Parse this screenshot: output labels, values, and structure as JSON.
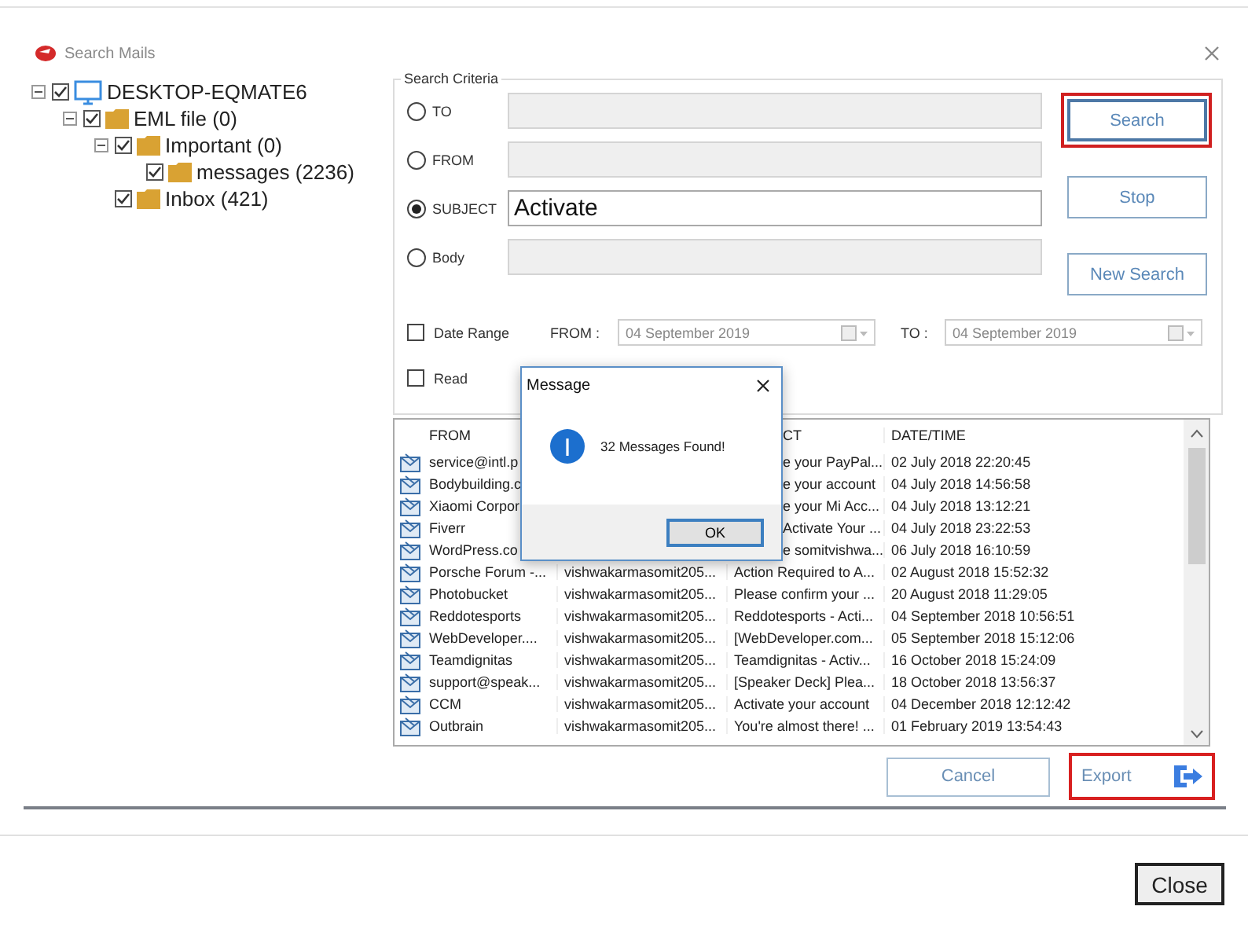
{
  "window": {
    "title": "Search Mails"
  },
  "tree": [
    {
      "label": "DESKTOP-EQMATE6",
      "kind": "computer",
      "checked": true,
      "expanded": true,
      "children": [
        {
          "label": "EML file (0)",
          "kind": "folder",
          "checked": true,
          "expanded": true,
          "children": [
            {
              "label": "Important (0)",
              "kind": "folder",
              "checked": true,
              "expanded": true,
              "children": [
                {
                  "label": "messages (2236)",
                  "kind": "folder",
                  "checked": true
                }
              ]
            },
            {
              "label": "Inbox (421)",
              "kind": "folder",
              "checked": true
            }
          ]
        }
      ]
    }
  ],
  "search_criteria": {
    "title": "Search Criteria",
    "fields": [
      {
        "label": "TO",
        "selected": false,
        "disabled": true
      },
      {
        "label": "FROM",
        "selected": false,
        "disabled": true
      },
      {
        "label": "SUBJECT",
        "selected": true,
        "disabled": false,
        "value": "Activate"
      },
      {
        "label": "Body",
        "selected": false,
        "disabled": true
      }
    ],
    "buttons": [
      {
        "label": "Search",
        "highlighted": true
      },
      {
        "label": "Stop",
        "highlighted": false
      },
      {
        "label": "New Search",
        "highlighted": false
      }
    ],
    "date_range": {
      "label": "Date Range",
      "checked": false,
      "from_label": "FROM :",
      "from_value": "04 September 2019",
      "to_label": "TO :",
      "to_value": "04 September 2019"
    },
    "filters": [
      {
        "label": "Read",
        "checked": false
      }
    ]
  },
  "table": {
    "header": {
      "from": "FROM",
      "subject": "CT",
      "date": "DATE/TIME"
    },
    "rows": [
      {
        "from": "service@intl.p",
        "subject": "e your PayPal...",
        "date": "02 July 2018 22:20:45"
      },
      {
        "from": "Bodybuilding.c",
        "subject": "e your account",
        "date": "04 July 2018 14:56:58"
      },
      {
        "from": "Xiaomi Corpor",
        "subject": "e your Mi Acc...",
        "date": "04 July 2018 13:12:21"
      },
      {
        "from": "Fiverr",
        "subject": "Activate Your ...",
        "date": "04 July 2018 23:22:53"
      },
      {
        "from": "WordPress.co",
        "subject": "e somitvishwa...",
        "date": "06 July 2018 16:10:59"
      },
      {
        "from": "Porsche Forum -...",
        "to": "vishwakarmasomit205...",
        "subject": "Action Required to A...",
        "date": "02 August 2018 15:52:32"
      },
      {
        "from": "Photobucket",
        "to": "vishwakarmasomit205...",
        "subject": "Please confirm your ...",
        "date": "20 August 2018 11:29:05"
      },
      {
        "from": "Reddotesports",
        "to": "vishwakarmasomit205...",
        "subject": "Reddotesports - Acti...",
        "date": "04 September 2018 10:56:51"
      },
      {
        "from": "WebDeveloper....",
        "to": "vishwakarmasomit205...",
        "subject": "[WebDeveloper.com...",
        "date": "05 September 2018 15:12:06"
      },
      {
        "from": "Teamdignitas",
        "to": "vishwakarmasomit205...",
        "subject": "Teamdignitas - Activ...",
        "date": "16 October 2018 15:24:09"
      },
      {
        "from": "support@speak...",
        "to": "vishwakarmasomit205...",
        "subject": "[Speaker Deck] Plea...",
        "date": "18 October 2018 13:56:37"
      },
      {
        "from": "CCM",
        "to": "vishwakarmasomit205...",
        "subject": "Activate your account",
        "date": "04 December 2018 12:12:42"
      },
      {
        "from": "Outbrain",
        "to": "vishwakarmasomit205...",
        "subject": "You're almost there! ...",
        "date": "01 February 2019 13:54:43"
      }
    ]
  },
  "actions": [
    {
      "label": "Cancel",
      "highlighted": false
    },
    {
      "label": "Export",
      "highlighted": true
    }
  ],
  "footer": {
    "button": "Close"
  },
  "dialog": {
    "title": "Message",
    "message": "32 Messages Found!",
    "button": "OK"
  }
}
